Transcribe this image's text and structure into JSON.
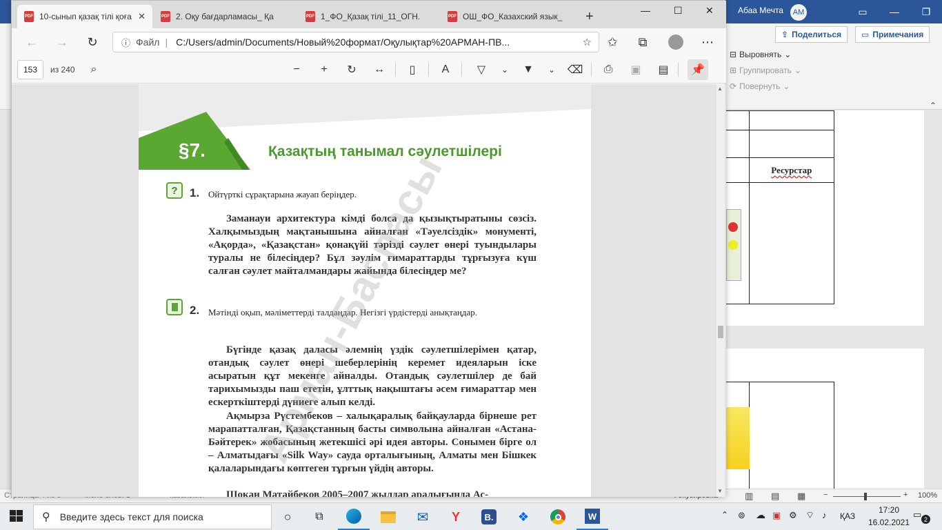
{
  "word": {
    "user_name": "Абаа Мечта",
    "user_initials": "АМ",
    "share_label": "Поделиться",
    "comments_label": "Примечания",
    "ribbon_items": [
      "Выровнять",
      "Группировать",
      "Повернуть"
    ],
    "table_header_resources": "Ресурстар",
    "status_left": "Страница 4 из 6",
    "status_words": "Число слов: 1",
    "status_lang": "казахский",
    "status_focus": "Фокусировка",
    "zoom": "100%"
  },
  "edge": {
    "tabs": [
      {
        "label": "10-сынып қазақ тілі қоға",
        "active": true
      },
      {
        "label": "2. Оқу бағдарламасы_ Қа",
        "active": false
      },
      {
        "label": "1_ФО_Қазақ тілі_11_ОГН.",
        "active": false
      },
      {
        "label": "ОШ_ФО_Казахский язык_",
        "active": false
      }
    ],
    "pdf_badge": "PDF",
    "address_prefix": "Файл",
    "address": "C:/Users/admin/Documents/Новый%20формат/Оқулықтар%20АРМАН-ПВ...",
    "page_current": "153",
    "page_total": "из 240"
  },
  "pdf": {
    "section_number": "§7.",
    "section_title": "Қазақтың танымал сәулетшілері",
    "watermark": "Арман-Баспасы",
    "task1_number": "1.",
    "task1_text": "Ойтүрткі сұрақтарына жауап беріңдер.",
    "task1_paragraph": "Заманауи архитектура кімді болса да қызықтыратыны сөзсіз. Халқымыздың мақтанышына айналған «Тәуелсіздік» монументі, «Ақорда», «Қазақстан» қонақүйі тәрізді сәулет өнері туындылары туралы не білесіңдер? Бұл зәулім ғимараттарды тұрғызуға күш салған сәулет майталмандары жайында білесіңдер ме?",
    "task2_number": "2.",
    "task2_text": "Мәтінді оқып, мәліметтерді талдаңдар. Негізгі үрдістерді анықтаңдар.",
    "para2": "Бүгінде қазақ даласы әлемнің үздік сәулетшілерімен қатар, отандық сәулет өнері шеберлерінің керемет идеяларын іске асыратын құт мекенге айналды. Отандық сәулетшілер де бай тарихымызды паш ететін, ұлттық нақыштағы әсем ғимараттар мен ескерткіштерді дүниеге алып келді.",
    "para3": "Ақмырза Рүстембеков – халықаралық байқауларда бірнеше рет марапатталған, Қазақстанның басты символына айналған «Астана-Бәйтерек» жобасының жетекшісі әрі идея авторы. Сонымен бірге ол – Алматыдағы «Silk Way» сауда орталығының, Алматы мен Бішкек қалаларындағы көптеген тұрғын үйдің авторы.",
    "para4": "Шоқан Матайбеков 2005–2007 жылдар аралығында Ас-"
  },
  "taskbar": {
    "search_placeholder": "Введите здесь текст для поиска",
    "lang": "ҚАЗ",
    "time": "17:20",
    "date": "16.02.2021",
    "notifications": "2"
  },
  "colors": {
    "word_blue": "#2b579a",
    "section_green": "#5aa832",
    "title_green": "#4a9a2a"
  }
}
